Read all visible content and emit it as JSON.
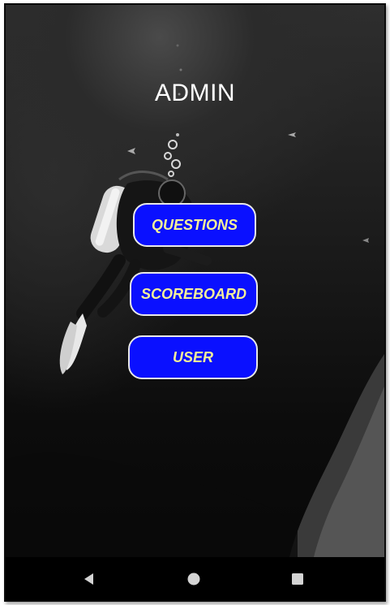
{
  "screen": {
    "title": "ADMIN"
  },
  "menu": {
    "questions_label": "QUESTIONS",
    "scoreboard_label": "SCOREBOARD",
    "user_label": "USER"
  },
  "colors": {
    "button_fill": "#0a10ff",
    "button_text": "#f4ef9a",
    "button_border": "#e8e8e8",
    "title_text": "#ffffff",
    "nav_bar": "#000000"
  },
  "navigation": {
    "icons": [
      "back-icon",
      "home-icon",
      "recents-icon"
    ]
  },
  "background": {
    "subject": "scuba diver underwater"
  }
}
